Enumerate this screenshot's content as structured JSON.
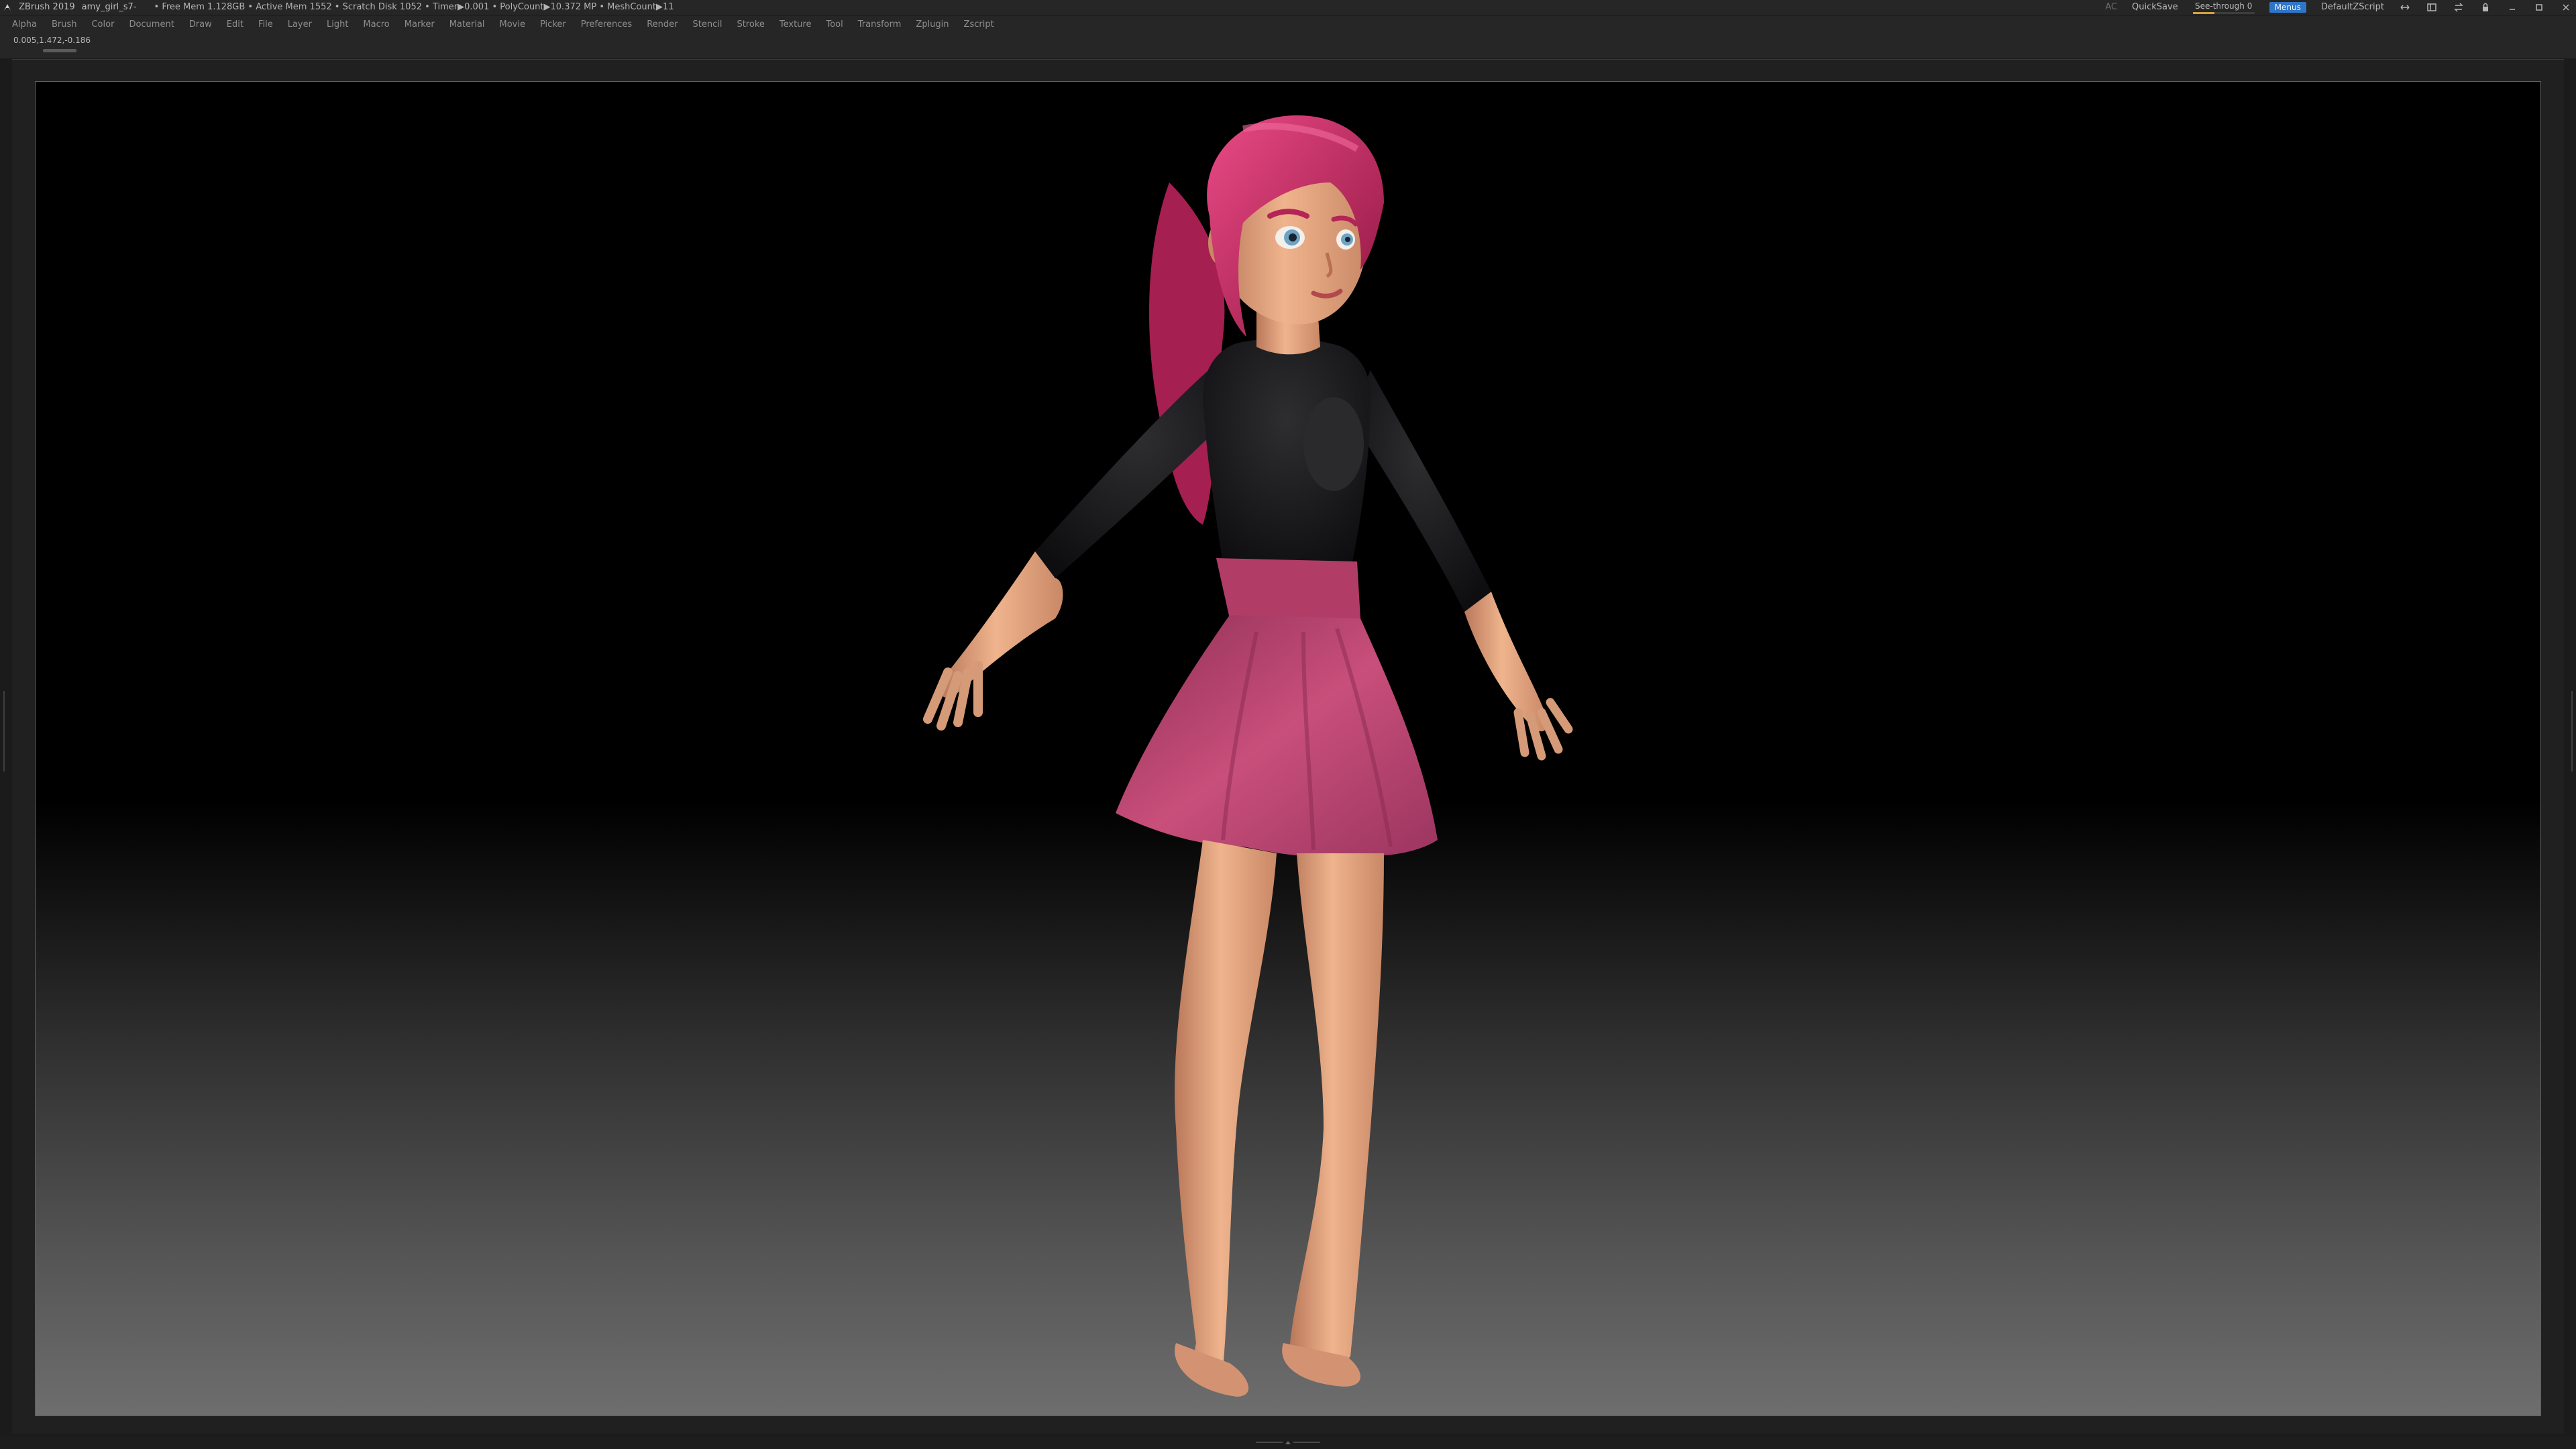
{
  "titlebar": {
    "app_name": "ZBrush 2019",
    "document": "amy_girl_s7-",
    "stats": "• Free Mem 1.128GB • Active Mem 1552 • Scratch Disk 1052 • Timer▶0.001 • PolyCount▶10.372 MP • MeshCount▶11",
    "ac_label": "AC",
    "quicksave_label": "QuickSave",
    "seethrough_label": "See-through 0",
    "seethrough_value": 0.35,
    "menus_label": "Menus",
    "script_label": "DefaultZScript"
  },
  "menubar": {
    "items": [
      "Alpha",
      "Brush",
      "Color",
      "Document",
      "Draw",
      "Edit",
      "File",
      "Layer",
      "Light",
      "Macro",
      "Marker",
      "Material",
      "Movie",
      "Picker",
      "Preferences",
      "Render",
      "Stencil",
      "Stroke",
      "Texture",
      "Tool",
      "Transform",
      "Zplugin",
      "Zscript"
    ]
  },
  "infostrip": {
    "coordinates": "0.005,1.472,-0.186"
  },
  "colors": {
    "panel": "#262626",
    "menu_text": "#8e8e8e",
    "menus_button": "#2f76c8",
    "hair": "#c2275f",
    "skin": "#e0a27c",
    "shirt": "#1d1d1f",
    "skirt": "#b8436a",
    "eye": "#6fa3c4"
  }
}
